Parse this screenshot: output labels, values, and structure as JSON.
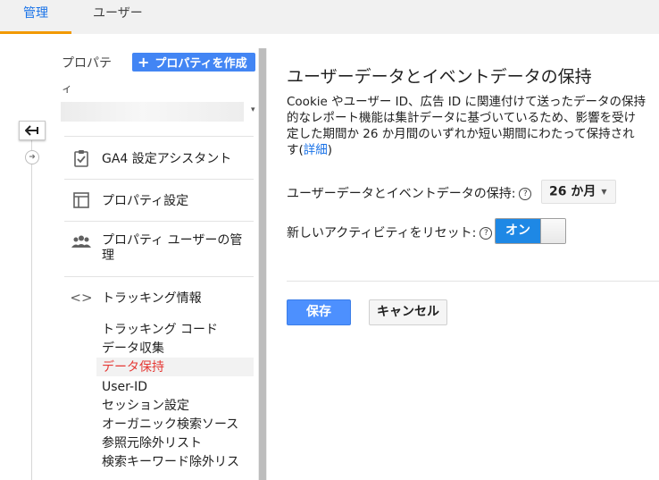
{
  "tabs": [
    {
      "label": "管理",
      "active": true
    },
    {
      "label": "ユーザー",
      "active": false
    }
  ],
  "colors": {
    "accent": "#1a73e8",
    "tab_underline": "#f29900",
    "create_button": "#4285f4",
    "active_item": "#e53935",
    "toggle_on": "#1e88e5"
  },
  "nav": {
    "back_icon": "arrow-left-icon",
    "forward_icon": "arrow-right-circle-icon"
  },
  "property_column": {
    "label_line1": "プロパテ",
    "label_line2": "ィ",
    "create_button": "プロパティを作成",
    "create_icon": "plus-icon"
  },
  "menu": [
    {
      "label": "GA4 設定アシスタント",
      "icon": "clipboard-check-icon"
    },
    {
      "label": "プロパティ設定",
      "icon": "layout-icon"
    },
    {
      "label": "プロパティ ユーザーの管理",
      "icon": "people-icon"
    },
    {
      "label": "トラッキング情報",
      "icon": "code-brackets-icon"
    }
  ],
  "tracking_sub": [
    {
      "label": "トラッキング コード",
      "active": false
    },
    {
      "label": "データ収集",
      "active": false
    },
    {
      "label": "データ保持",
      "active": true
    },
    {
      "label": "User-ID",
      "active": false
    },
    {
      "label": "セッション設定",
      "active": false
    },
    {
      "label": "オーガニック検索ソース",
      "active": false
    },
    {
      "label": "参照元除外リスト",
      "active": false
    },
    {
      "label": "検索キーワード除外リス",
      "active": false
    }
  ],
  "content": {
    "title": "ユーザーデータとイベントデータの保持",
    "desc_line1": "Cookie やユーザー ID、広告 ID に関連付けて送ったデータの保持",
    "desc_line2": "的なレポート機能は集計データに基づいているため、影響を受け",
    "desc_line3": "定した期間か 26 か月間のいずれか短い期間にわたって保持され",
    "desc_line4": "す",
    "desc_link": "詳細",
    "retention_label": "ユーザーデータとイベントデータの保持:",
    "retention_value": "26 か月",
    "reset_label": "新しいアクティビティをリセット:",
    "toggle_label": "オン",
    "help_icon": "help-circle-icon",
    "save": "保存",
    "cancel": "キャンセル"
  }
}
